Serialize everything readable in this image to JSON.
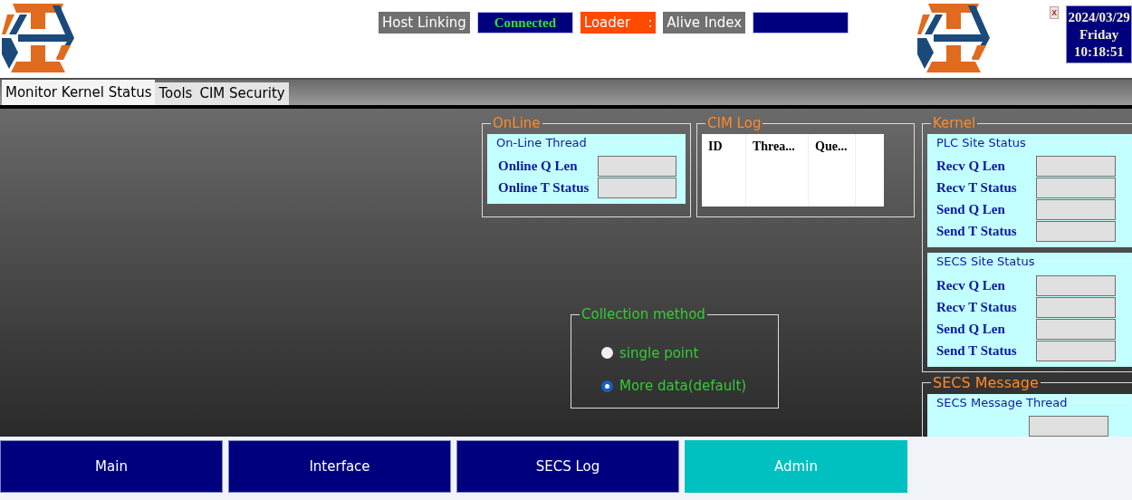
{
  "header": {
    "indicators": [
      {
        "kind": "label",
        "text": "Host Linking"
      },
      {
        "kind": "value",
        "text": "Connected"
      },
      {
        "kind": "alert",
        "text": "Loader    :"
      },
      {
        "kind": "label",
        "text": "Alive Index"
      },
      {
        "kind": "value"
      }
    ],
    "close_button": "x",
    "clock": {
      "date": "2024/03/29",
      "day": "Friday",
      "time": "10:18:51"
    }
  },
  "tabs": [
    {
      "label": "Monitor Kernel Status",
      "selected": true
    },
    {
      "label": "Tools",
      "selected": false
    },
    {
      "label": "CIM Security",
      "selected": false
    }
  ],
  "online": {
    "title": "OnLine",
    "group_title": "On-Line Thread",
    "rows": [
      "Online Q Len",
      "Online T Status"
    ]
  },
  "cim_log": {
    "title": "CIM Log",
    "columns": [
      "ID",
      "Threa...",
      "Que..."
    ]
  },
  "collection": {
    "title": "Collection method",
    "options": [
      {
        "label": "single point",
        "selected": false
      },
      {
        "label": "More data(default)",
        "selected": true
      }
    ]
  },
  "kernel": {
    "title": "Kernel",
    "groups": [
      {
        "title": "PLC Site Status",
        "rows": [
          "Recv Q Len",
          "Recv T Status",
          "Send Q Len",
          "Send T Status"
        ]
      },
      {
        "title": "SECS Site Status",
        "rows": [
          "Recv Q Len",
          "Recv T Status",
          "Send Q Len",
          "Send T Status"
        ]
      }
    ]
  },
  "secs_message": {
    "title": "SECS Message",
    "group_title": "SECS Message Thread"
  },
  "nav_buttons": [
    {
      "label": "Main",
      "selected": false
    },
    {
      "label": "Interface",
      "selected": false
    },
    {
      "label": "SECS Log",
      "selected": false
    },
    {
      "label": "Admin",
      "selected": true
    }
  ]
}
